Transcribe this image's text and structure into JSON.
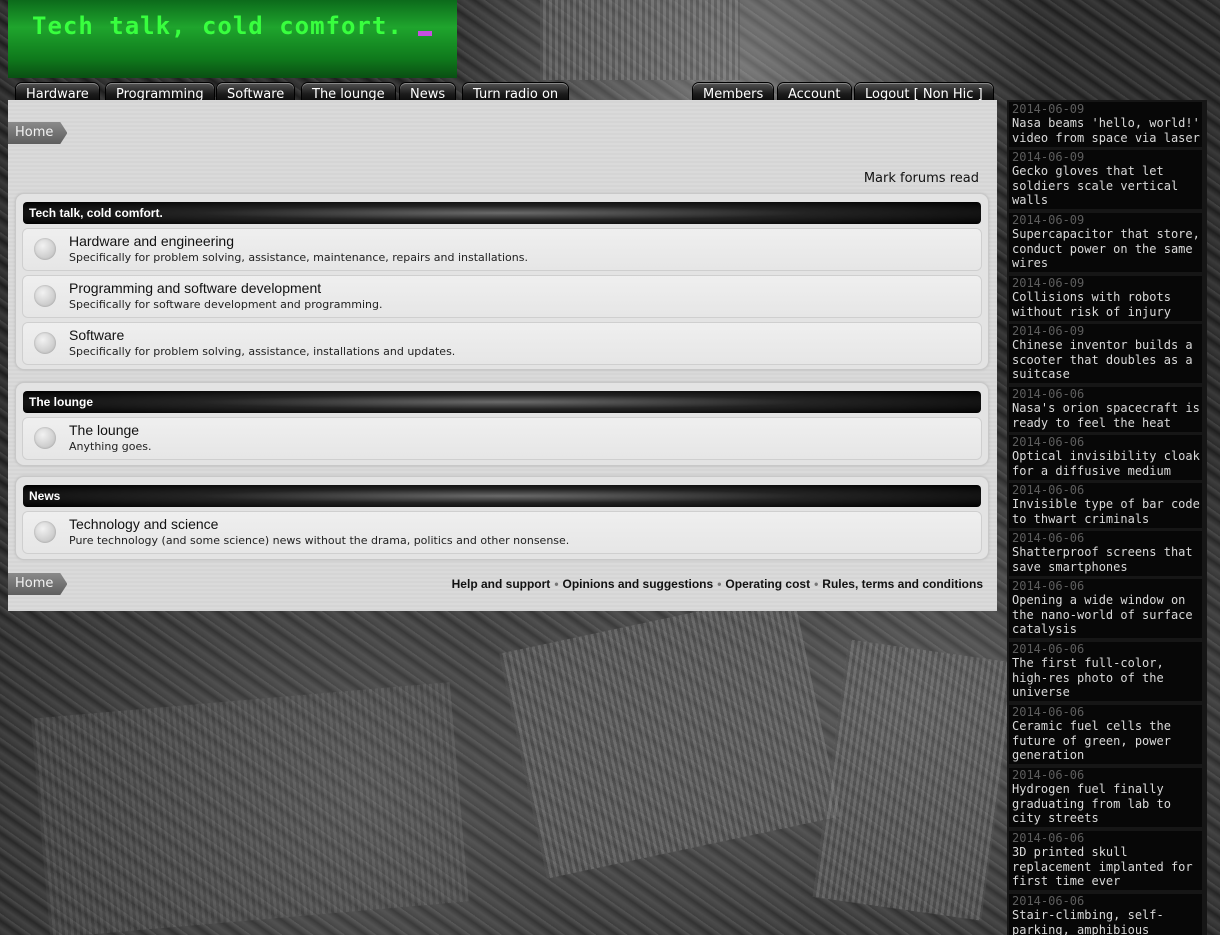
{
  "site": {
    "banner_title": "Tech talk, cold comfort."
  },
  "nav_left": [
    "Hardware",
    "Programming",
    "Software",
    "The lounge",
    "News",
    "Turn radio on"
  ],
  "nav_right": [
    "Members",
    "Account",
    "Logout [ Non Hic ]"
  ],
  "breadcrumb": {
    "home_top": "Home",
    "home_bottom": "Home"
  },
  "mark_forums_read": "Mark forums read",
  "categories": [
    {
      "title": "Tech talk, cold comfort.",
      "forums": [
        {
          "title": "Hardware and engineering",
          "desc": "Specifically for problem solving, assistance, maintenance, repairs and installations."
        },
        {
          "title": "Programming and software development",
          "desc": "Specifically for software development and programming."
        },
        {
          "title": "Software",
          "desc": "Specifically for problem solving, assistance, installations and updates."
        }
      ]
    },
    {
      "title": "The lounge",
      "forums": [
        {
          "title": "The lounge",
          "desc": "Anything goes."
        }
      ]
    },
    {
      "title": "News",
      "forums": [
        {
          "title": "Technology and science",
          "desc": "Pure technology (and some science) news without the drama, politics and other nonsense."
        }
      ]
    }
  ],
  "footer_links": [
    "Help and support",
    "Opinions and suggestions",
    "Operating cost",
    "Rules, terms and conditions"
  ],
  "news": [
    {
      "date": "2014-06-09",
      "title": "Nasa beams 'hello, world!' video from space via laser"
    },
    {
      "date": "2014-06-09",
      "title": "Gecko gloves that let soldiers scale vertical walls"
    },
    {
      "date": "2014-06-09",
      "title": "Supercapacitor that store, conduct power on the same wires"
    },
    {
      "date": "2014-06-09",
      "title": "Collisions with robots without risk of injury"
    },
    {
      "date": "2014-06-09",
      "title": "Chinese inventor builds a scooter that doubles as a suitcase"
    },
    {
      "date": "2014-06-06",
      "title": "Nasa's orion spacecraft is ready to feel the heat"
    },
    {
      "date": "2014-06-06",
      "title": "Optical invisibility cloak for a diffusive medium"
    },
    {
      "date": "2014-06-06",
      "title": "Invisible type of bar code to thwart criminals"
    },
    {
      "date": "2014-06-06",
      "title": "Shatterproof screens that save smartphones"
    },
    {
      "date": "2014-06-06",
      "title": "Opening a wide window on the nano-world of surface catalysis"
    },
    {
      "date": "2014-06-06",
      "title": "The first full-color, high-res photo of the universe"
    },
    {
      "date": "2014-06-06",
      "title": "Ceramic fuel cells the future of green, power generation"
    },
    {
      "date": "2014-06-06",
      "title": "Hydrogen fuel finally graduating from lab to city streets"
    },
    {
      "date": "2014-06-06",
      "title": "3D printed skull replacement implanted for first time ever"
    },
    {
      "date": "2014-06-06",
      "title": "Stair-climbing, self-parking, amphibious"
    }
  ]
}
